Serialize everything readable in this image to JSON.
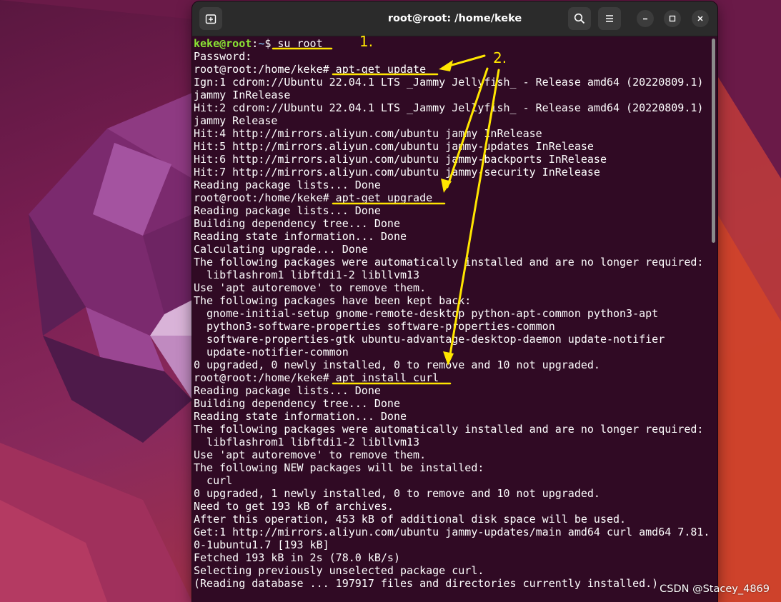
{
  "window": {
    "title": "root@root: /home/keke"
  },
  "titlebar": {
    "new_tab_icon": "new-tab-icon",
    "search_icon": "search-icon",
    "menu_icon": "hamburger-menu-icon",
    "minimize_icon": "minimize-icon",
    "maximize_icon": "maximize-icon",
    "close_icon": "close-icon"
  },
  "prompt": {
    "user_host": "keke@root",
    "path": "~",
    "symbol": "$",
    "command": " su root"
  },
  "lines": [
    "Password:",
    "root@root:/home/keke# apt-get update",
    "Ign:1 cdrom://Ubuntu 22.04.1 LTS _Jammy Jellyfish_ - Release amd64 (20220809.1)",
    "jammy InRelease",
    "Hit:2 cdrom://Ubuntu 22.04.1 LTS _Jammy Jellyfish_ - Release amd64 (20220809.1)",
    "jammy Release",
    "Hit:4 http://mirrors.aliyun.com/ubuntu jammy InRelease",
    "Hit:5 http://mirrors.aliyun.com/ubuntu jammy-updates InRelease",
    "Hit:6 http://mirrors.aliyun.com/ubuntu jammy-backports InRelease",
    "Hit:7 http://mirrors.aliyun.com/ubuntu jammy-security InRelease",
    "Reading package lists... Done",
    "root@root:/home/keke# apt-get upgrade",
    "Reading package lists... Done",
    "Building dependency tree... Done",
    "Reading state information... Done",
    "Calculating upgrade... Done",
    "The following packages were automatically installed and are no longer required:",
    "  libflashrom1 libftdi1-2 libllvm13",
    "Use 'apt autoremove' to remove them.",
    "The following packages have been kept back:",
    "  gnome-initial-setup gnome-remote-desktop python-apt-common python3-apt",
    "  python3-software-properties software-properties-common",
    "  software-properties-gtk ubuntu-advantage-desktop-daemon update-notifier",
    "  update-notifier-common",
    "0 upgraded, 0 newly installed, 0 to remove and 10 not upgraded.",
    "root@root:/home/keke# apt install curl",
    "Reading package lists... Done",
    "Building dependency tree... Done",
    "Reading state information... Done",
    "The following packages were automatically installed and are no longer required:",
    "  libflashrom1 libftdi1-2 libllvm13",
    "Use 'apt autoremove' to remove them.",
    "The following NEW packages will be installed:",
    "  curl",
    "0 upgraded, 1 newly installed, 0 to remove and 10 not upgraded.",
    "Need to get 193 kB of archives.",
    "After this operation, 453 kB of additional disk space will be used.",
    "Get:1 http://mirrors.aliyun.com/ubuntu jammy-updates/main amd64 curl amd64 7.81.",
    "0-1ubuntu1.7 [193 kB]",
    "Fetched 193 kB in 2s (78.0 kB/s)",
    "Selecting previously unselected package curl.",
    "(Reading database ... 197917 files and directories currently installed.)"
  ],
  "annotations": {
    "label_1": "1.",
    "label_2": "2.",
    "color": "#ffe600"
  },
  "watermark": "CSDN @Stacey_4869"
}
